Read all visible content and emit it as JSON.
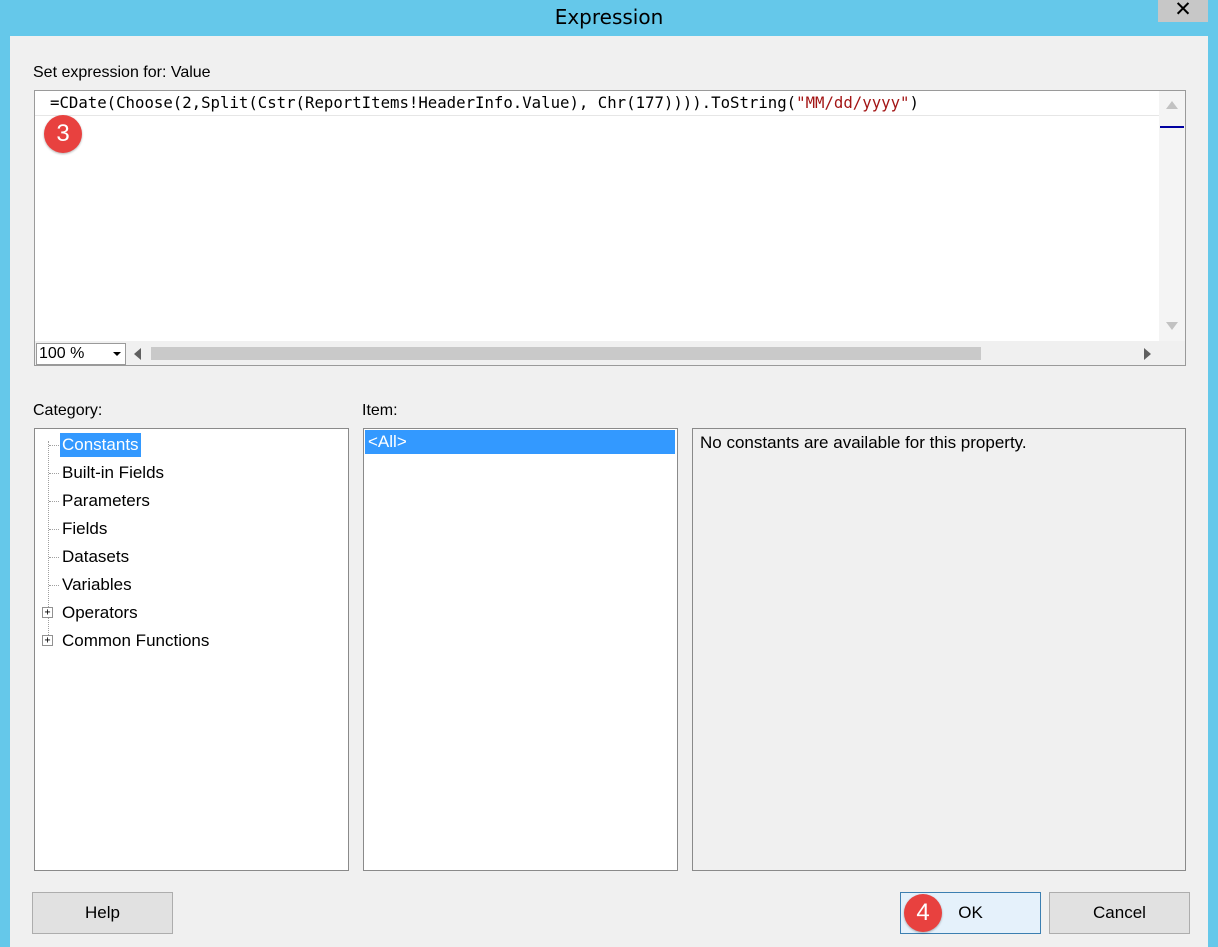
{
  "window": {
    "title": "Expression",
    "close_glyph": "✕"
  },
  "editor": {
    "label": "Set expression for: Value",
    "code_prefix": "=CDate(Choose(2,Split(Cstr(ReportItems!HeaderInfo.Value), Chr(177)))).ToString(",
    "code_string": "\"MM/dd/yyyy\"",
    "code_suffix": ")",
    "zoom_value": "100 %"
  },
  "badges": {
    "step3": "3",
    "step4": "4"
  },
  "category": {
    "label": "Category:",
    "items": [
      {
        "label": "Constants",
        "selected": true
      },
      {
        "label": "Built-in Fields"
      },
      {
        "label": "Parameters"
      },
      {
        "label": "Fields"
      },
      {
        "label": "Datasets"
      },
      {
        "label": "Variables"
      },
      {
        "label": "Operators",
        "expandable": true
      },
      {
        "label": "Common Functions",
        "expandable": true
      }
    ]
  },
  "item": {
    "label": "Item:",
    "items": [
      "<All>"
    ]
  },
  "description": {
    "text": "No constants are available for this property."
  },
  "buttons": {
    "help": "Help",
    "ok": "OK",
    "cancel": "Cancel"
  },
  "colors": {
    "titlebar": "#65c8ea",
    "selection": "#3399ff",
    "badge": "#e8413f",
    "string_literal": "#a31515"
  }
}
